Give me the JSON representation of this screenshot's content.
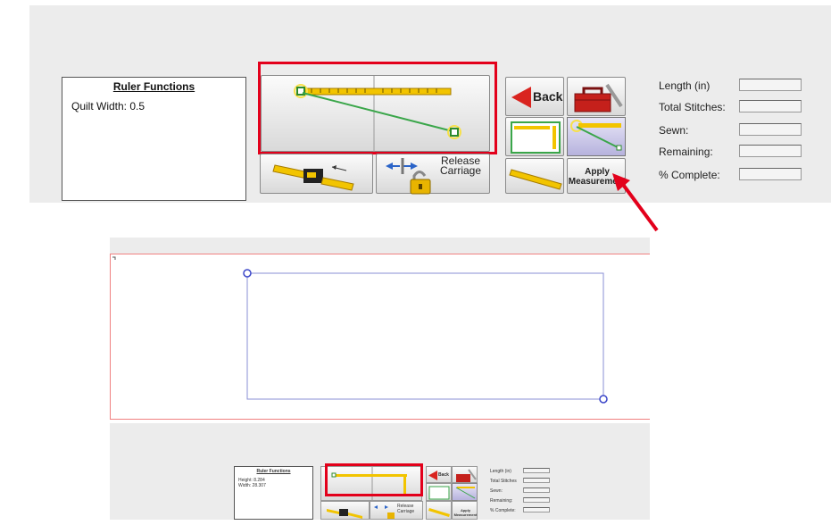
{
  "top_panel": {
    "ruler_functions": {
      "title": "Ruler Functions",
      "line1": "Quilt Width: 0.5"
    },
    "buttons": {
      "back_label": "Back",
      "release_carriage_line1": "Release",
      "release_carriage_line2": "Carriage",
      "apply_line1": "Apply",
      "apply_line2": "Measurement"
    },
    "stats": {
      "length_label": "Length (in)",
      "total_stitches_label": "Total Stitches:",
      "sewn_label": "Sewn:",
      "remaining_label": "Remaining:",
      "complete_label": "% Complete:"
    }
  },
  "mini_panel": {
    "ruler_functions": {
      "title": "Ruler Functions",
      "line1": "Height: 8.284",
      "line2": "Width: 28.307"
    },
    "buttons": {
      "back_label": "Back",
      "release_carriage_line1": "Release",
      "release_carriage_line2": "Carriage",
      "apply_line1": "Apply",
      "apply_line2": "Measurement"
    },
    "stats": {
      "length_label": "Length (in)",
      "total_stitches_label": "Total Stitches",
      "sewn_label": "Sewn:",
      "remaining_label": "Remaining:",
      "complete_label": "% Complete:"
    }
  },
  "colors": {
    "highlight": "#e3001b",
    "shape_outline": "#8a8fd6",
    "ruler_yellow": "#f2c400",
    "line_green": "#3aa64a",
    "back_arrow": "#d9241f",
    "toolbox": "#c5201b",
    "canvas_border": "#f08080"
  },
  "icons": [
    "ruler-icon",
    "red-arrow-icon",
    "toolbox-icon",
    "padlock-icon",
    "tape-measure-icon",
    "corner-handle-icon"
  ]
}
